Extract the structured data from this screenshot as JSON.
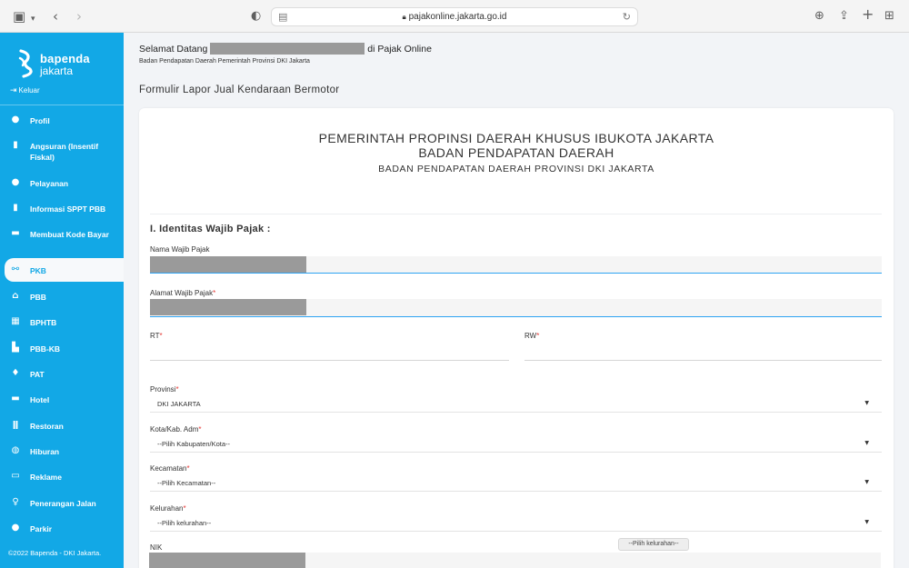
{
  "browser": {
    "url": "pajakonline.jakarta.go.id",
    "icons": [
      "sidebar-toggle-icon",
      "chevron-down-icon",
      "back-icon",
      "forward-icon",
      "privacy-shield-icon",
      "reader-icon",
      "lock-icon",
      "reload-icon",
      "download-icon",
      "share-icon",
      "new-tab-icon",
      "tab-overview-icon"
    ]
  },
  "sidebar": {
    "logo_primary": "bapenda",
    "logo_secondary": "jakarta",
    "logout_label": "Keluar",
    "items": [
      {
        "label": "Profil",
        "icon": "user-icon"
      },
      {
        "label": "Angsuran (Insentif Fiskal)",
        "icon": "document-icon"
      },
      {
        "label": "Pelayanan",
        "icon": "chat-icon"
      },
      {
        "label": "Informasi SPPT PBB",
        "icon": "receipt-icon"
      },
      {
        "label": "Membuat Kode Bayar",
        "icon": "money-icon"
      },
      {
        "label": "PKB",
        "icon": "motorcycle-icon"
      },
      {
        "label": "PBB",
        "icon": "home-icon"
      },
      {
        "label": "BPHTB",
        "icon": "building-icon"
      },
      {
        "label": "PBB-KB",
        "icon": "gas-pump-icon"
      },
      {
        "label": "PAT",
        "icon": "water-drop-icon"
      },
      {
        "label": "Hotel",
        "icon": "bed-icon"
      },
      {
        "label": "Restoran",
        "icon": "utensils-icon"
      },
      {
        "label": "Hiburan",
        "icon": "globe-icon"
      },
      {
        "label": "Reklame",
        "icon": "billboard-icon"
      },
      {
        "label": "Penerangan Jalan",
        "icon": "lightbulb-icon"
      },
      {
        "label": "Parkir",
        "icon": "parking-icon"
      }
    ],
    "active_item": "PKB",
    "footer": "©2022 Bapenda - DKI Jakarta."
  },
  "header": {
    "welcome_prefix": "Selamat Datang",
    "welcome_suffix": "di Pajak Online",
    "subtitle": "Badan Pendapatan Daerah Pemerintah Provinsi DKI Jakarta",
    "form_title": "Formulir Lapor Jual Kendaraan Bermotor"
  },
  "card": {
    "heading_1": "PEMERINTAH PROPINSI DAERAH KHUSUS IBUKOTA JAKARTA",
    "heading_2": "BADAN PENDAPATAN DAERAH",
    "heading_3": "BADAN PENDAPATAN DAERAH PROVINSI DKI JAKARTA",
    "section_title": "I. Identitas Wajib Pajak :"
  },
  "form": {
    "nama_label": "Nama Wajib Pajak",
    "alamat_label": "Alamat Wajib Pajak",
    "rt_label": "RT",
    "rw_label": "RW",
    "provinsi_label": "Provinsi",
    "provinsi_value": "DKI JAKARTA",
    "kota_label": "Kota/Kab. Adm",
    "kota_value": "--Pilih Kabupaten/Kota--",
    "kecamatan_label": "Kecamatan",
    "kecamatan_value": "--Pilih Kecamatan--",
    "kelurahan_label": "Kelurahan",
    "kelurahan_value": "--Pilih kelurahan--",
    "tooltip": "--Pilih kelurahan--",
    "nik_label": "NIK",
    "required_mark": "*",
    "accent_color": "#12a8e6",
    "required_color": "#e53935"
  }
}
